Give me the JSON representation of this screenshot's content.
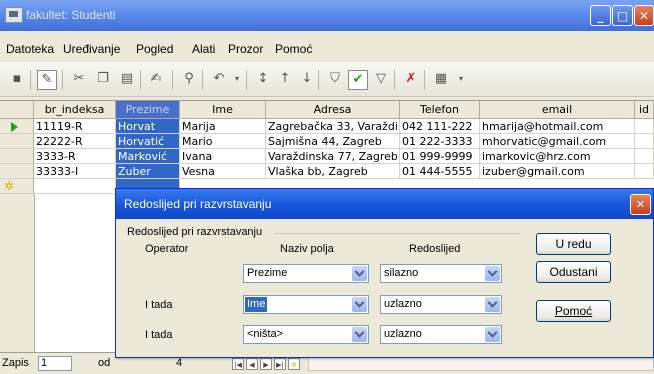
{
  "window": {
    "title": "fakultet: Studenti"
  },
  "menu": [
    "Datoteka",
    "Uređivanje",
    "Pogled",
    "Alati",
    "Prozor",
    "Pomoć"
  ],
  "grid": {
    "columns": [
      "br_indeksa",
      "Prezime",
      "Ime",
      "Adresa",
      "Telefon",
      "email",
      "id"
    ],
    "rows": [
      [
        "11119-R",
        "Horvat",
        "Marija",
        "Zagrebačka 33, Varaždin",
        "042 111-222",
        "hmarija@hotmail.com"
      ],
      [
        "22222-R",
        "Horvatić",
        "Mario",
        "Sajmišna 44, Zagreb",
        "01 222-3333",
        "mhorvatic@gmail.com"
      ],
      [
        "3333-R",
        "Marković",
        "Ivana",
        "Varaždinska 77, Zagreb",
        "01 999-9999",
        "imarkovic@hrz.com"
      ],
      [
        "33333-I",
        "Zuber",
        "Vesna",
        "Vlaška bb, Zagreb",
        "01 444-5555",
        "izuber@gmail.com"
      ]
    ]
  },
  "status": {
    "record_label": "Zapis",
    "record_value": "1",
    "of_label": "od",
    "count": "4"
  },
  "dialog": {
    "title": "Redoslijed pri razvrstavanju",
    "group_label": "Redoslijed pri razvrstavanju",
    "col_operator": "Operator",
    "col_field": "Naziv polja",
    "col_order": "Redoslijed",
    "rows": [
      {
        "operator": "",
        "field": "Prezime",
        "order": "silazno"
      },
      {
        "operator": "I tada",
        "field": "Ime",
        "order": "uzlazno"
      },
      {
        "operator": "I tada",
        "field": "<ništa>",
        "order": "uzlazno"
      }
    ],
    "ok_label": "U redu",
    "cancel_label": "Odustani",
    "help_label": "Pomoć"
  }
}
